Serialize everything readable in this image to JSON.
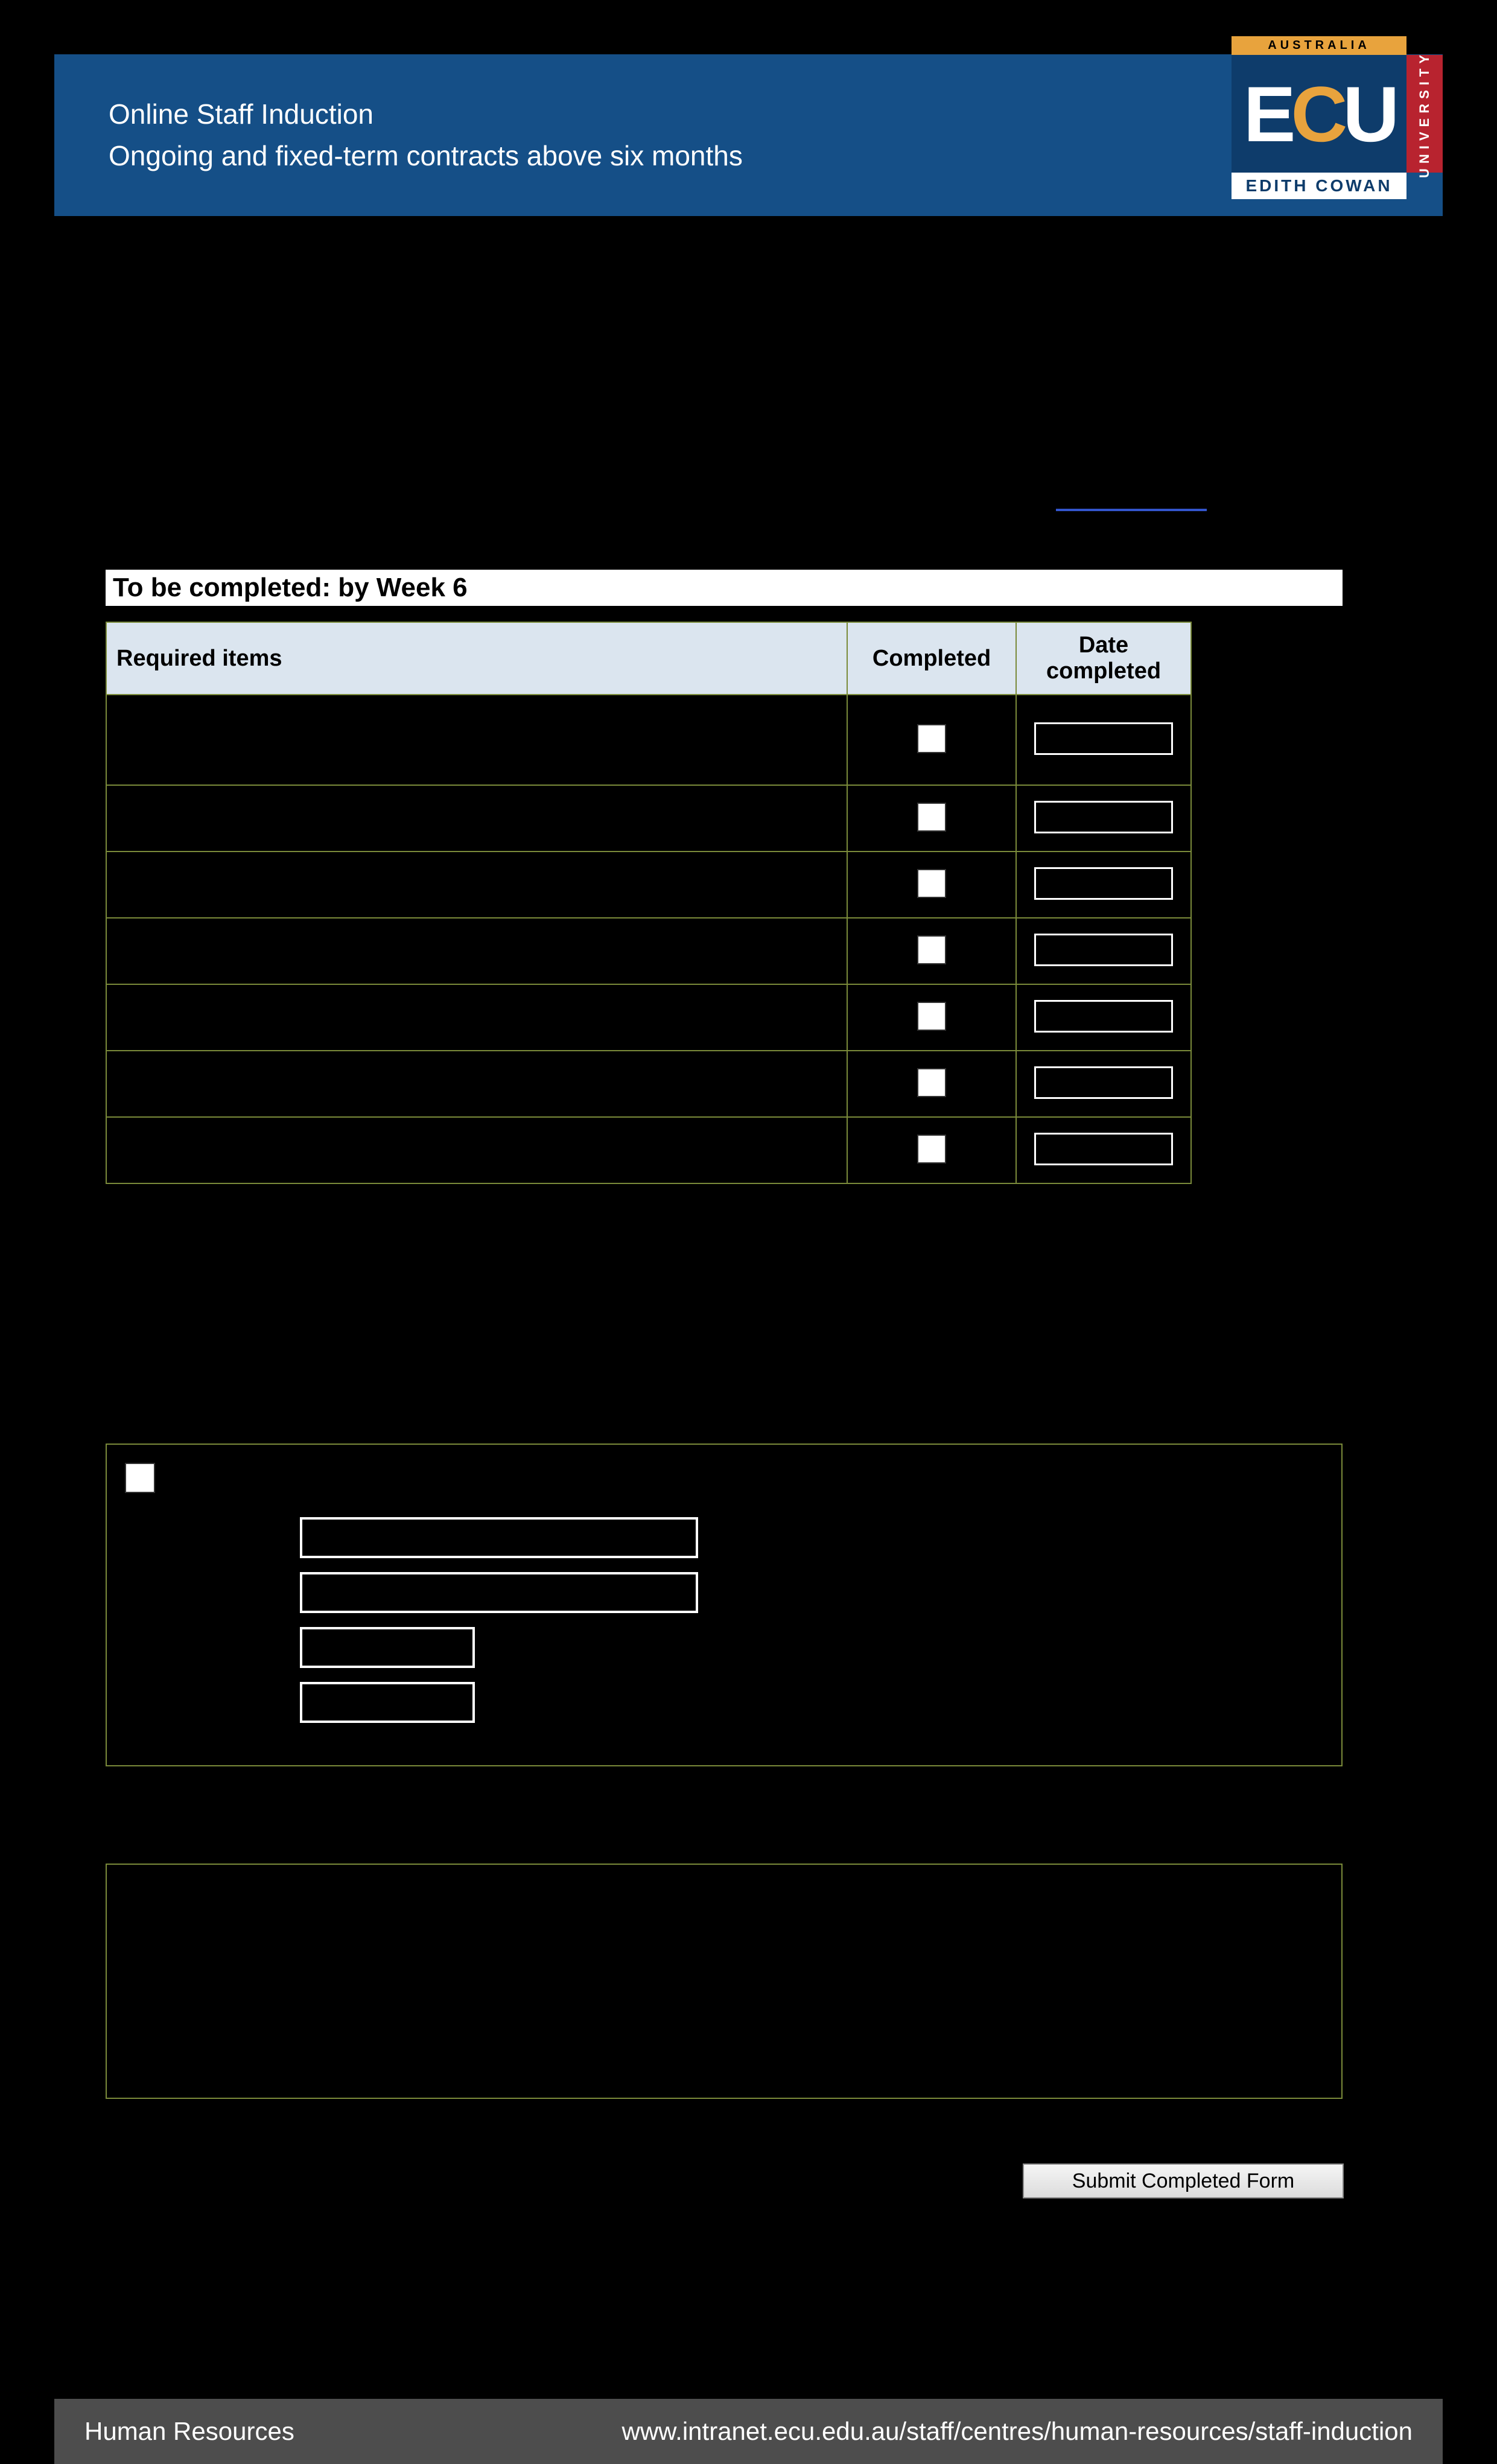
{
  "header": {
    "title_line1": "Online Staff Induction",
    "title_line2": "Ongoing and fixed-term contracts above six months"
  },
  "logo": {
    "top_banner": "AUSTRALIA",
    "main": "ECU",
    "vertical": "UNIVERSITY",
    "bottom": "EDITH COWAN"
  },
  "section": {
    "heading": "To be completed: by Week 6"
  },
  "table": {
    "col_required": "Required items",
    "col_completed": "Completed",
    "col_date": "Date completed"
  },
  "submit": {
    "label": "Submit Completed Form"
  },
  "footer": {
    "left": "Human Resources",
    "right": "www.intranet.ecu.edu.au/staff/centres/human-resources/staff-induction"
  }
}
